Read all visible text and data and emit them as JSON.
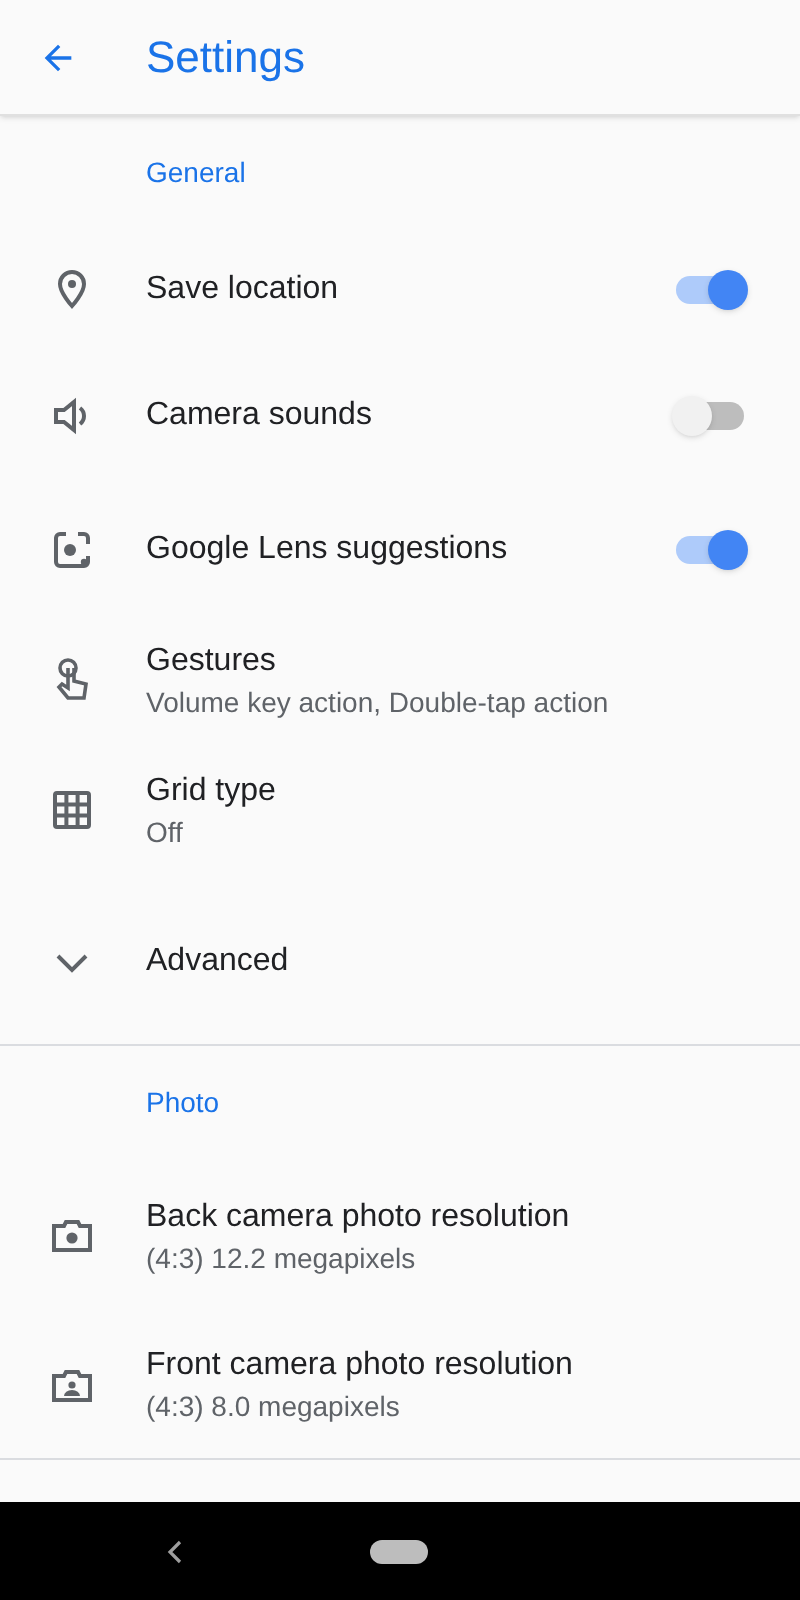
{
  "app_bar": {
    "title": "Settings"
  },
  "sections": [
    {
      "heading": "General",
      "items": [
        {
          "kind": "toggle",
          "title": "Save location",
          "on": true
        },
        {
          "kind": "toggle",
          "title": "Camera sounds",
          "on": false
        },
        {
          "kind": "toggle",
          "title": "Google Lens suggestions",
          "on": true
        },
        {
          "kind": "text",
          "title": "Gestures",
          "subtitle": "Volume key action, Double-tap action"
        },
        {
          "kind": "text",
          "title": "Grid type",
          "subtitle": "Off"
        },
        {
          "kind": "expander",
          "title": "Advanced",
          "expanded": false
        }
      ]
    },
    {
      "heading": "Photo",
      "items": [
        {
          "kind": "text",
          "title": "Back camera photo resolution",
          "subtitle": "(4:3) 12.2 megapixels"
        },
        {
          "kind": "text",
          "title": "Front camera photo resolution",
          "subtitle": "(4:3) 8.0 megapixels"
        }
      ]
    }
  ]
}
